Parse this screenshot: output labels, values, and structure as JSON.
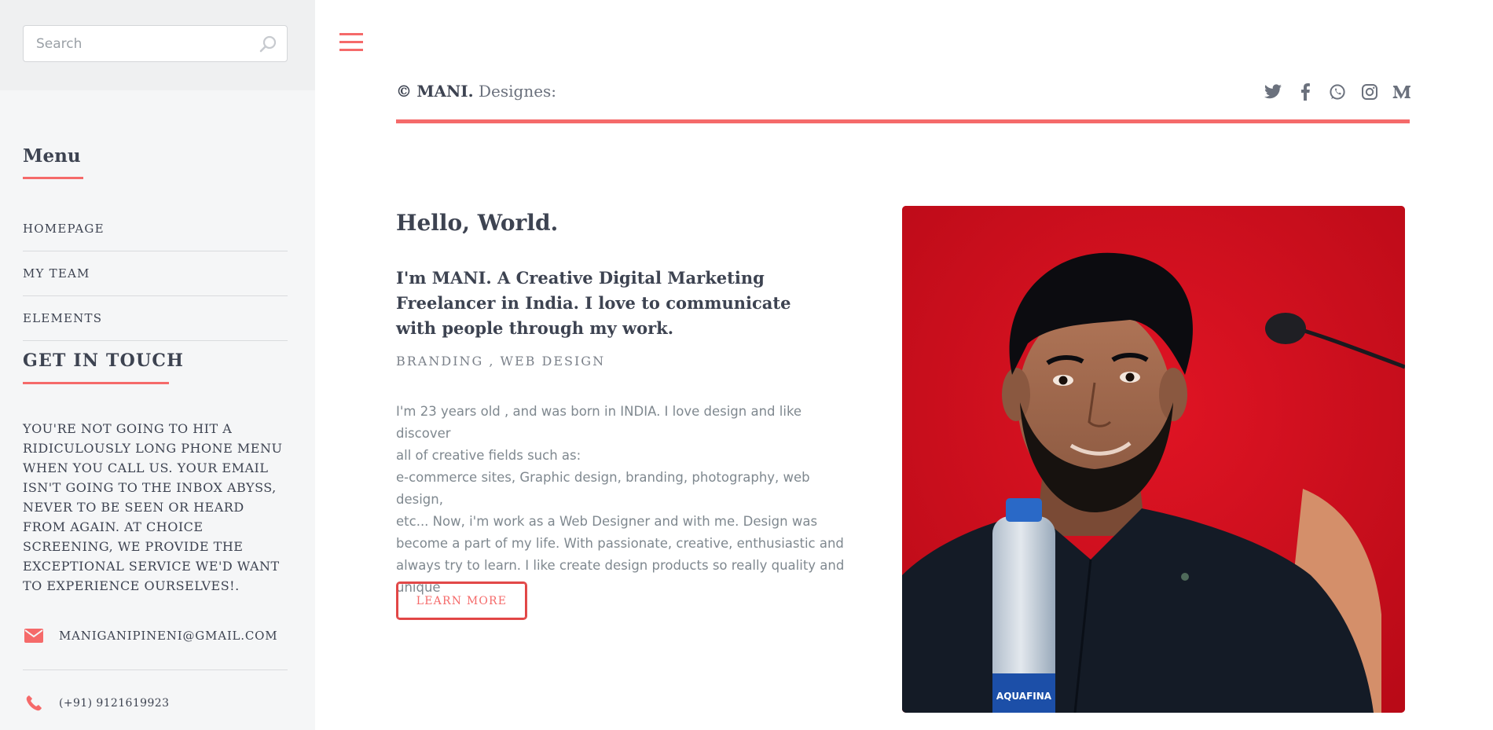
{
  "sidebar": {
    "search": {
      "placeholder": "Search"
    },
    "menu": {
      "title": "Menu",
      "items": [
        {
          "label": "HOMEPAGE"
        },
        {
          "label": "MY TEAM"
        },
        {
          "label": "ELEMENTS"
        }
      ]
    },
    "get_in_touch": {
      "title": "GET IN TOUCH",
      "text": "YOU'RE NOT GOING TO HIT A RIDICULOUSLY LONG PHONE MENU WHEN YOU CALL US. YOUR EMAIL ISN'T GOING TO THE INBOX ABYSS, NEVER TO BE SEEN OR HEARD FROM AGAIN. AT CHOICE SCREENING, WE PROVIDE THE EXCEPTIONAL SERVICE WE'D WANT TO EXPERIENCE OURSELVES!.",
      "email": "MANIGANIPINENI@GMAIL.COM",
      "phone": "(+91) 9121619923"
    }
  },
  "header": {
    "brand_copy": "©",
    "brand_name": "MANI.",
    "brand_suffix": "Designes:",
    "socials": [
      "twitter-icon",
      "facebook-icon",
      "whatsapp-icon",
      "instagram-icon",
      "medium-icon"
    ]
  },
  "main": {
    "hello": "Hello, World.",
    "intro": "I'm MANI. A Creative Digital Marketing Freelancer in India. I love to communicate with people through my work.",
    "tags": "BRANDING , WEB DESIGN",
    "bio": "I'm 23 years old , and was born in INDIA. I love design and like discover all of creative fields such as: e-commerce sites, Graphic design, branding, photography, web design, etc... Now, i'm work as a Web Designer and with me. Design was become a part of my life. With passionate, creative, enthusiastic and always try to learn. I like create design products so really quality and unique",
    "bio_lines": [
      "I'm 23 years old , and was born in INDIA. I love design and like discover",
      "all of creative fields such as:",
      "e-commerce sites, Graphic design, branding, photography, web design,",
      "etc... Now, i'm work as a Web Designer and with me. Design was",
      "become a part of my life. With passionate, creative, enthusiastic and",
      "always try to learn. I like create design products so really quality and",
      "unique"
    ],
    "learn_more": "LEARN MORE",
    "photo_label": "AQUAFINA"
  },
  "colors": {
    "accent": "#f56a6a",
    "text": "#3d4351",
    "muted": "#7f888f",
    "sidebar_bg": "#f5f6f7",
    "photo_bg": "#d3101c"
  }
}
